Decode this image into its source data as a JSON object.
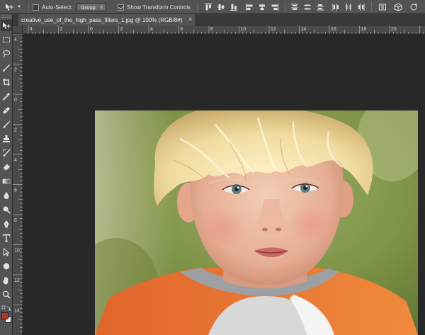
{
  "options_bar": {
    "auto_select_label": "Auto-Select:",
    "auto_select_checked": false,
    "group_select_value": "Group",
    "show_transform_label": "Show Transform Controls",
    "show_transform_checked": true,
    "tool_icon": "move-icon",
    "align_icons": [
      "align-top-edges-icon",
      "align-vertical-centers-icon",
      "align-bottom-edges-icon",
      "align-left-edges-icon",
      "align-horizontal-centers-icon",
      "align-right-edges-icon",
      "distribute-top-icon",
      "distribute-vertical-centers-icon",
      "distribute-bottom-icon",
      "distribute-left-icon",
      "distribute-horizontal-centers-icon",
      "distribute-right-icon"
    ]
  },
  "document": {
    "tab_title": "creative_use_of_the_high_pass_filters_1.jpg @ 100% (RGB/8#)",
    "close_glyph": "×"
  },
  "rulers": {
    "top_labels": [
      "4",
      "2",
      "0",
      "2",
      "4",
      "6",
      "8",
      "10",
      "12",
      "14",
      "16",
      "18",
      "20"
    ],
    "left_labels": [
      "4",
      "2",
      "0",
      "2",
      "4",
      "6",
      "8",
      "10",
      "12",
      "14"
    ]
  },
  "tools": [
    "move-icon",
    "marquee-icon",
    "lasso-icon",
    "quick-selection-icon",
    "crop-icon",
    "eyedropper-icon",
    "healing-brush-icon",
    "brush-icon",
    "clone-stamp-icon",
    "history-brush-icon",
    "eraser-icon",
    "gradient-icon",
    "blur-icon",
    "dodge-icon",
    "pen-icon",
    "type-icon",
    "path-selection-icon",
    "shape-icon",
    "hand-icon",
    "zoom-icon",
    "foreground-background-colors-icon"
  ],
  "colors": {
    "panel": "#535353",
    "workspace": "#282828",
    "foreground": "#b4322a",
    "background": "#ffffff"
  }
}
